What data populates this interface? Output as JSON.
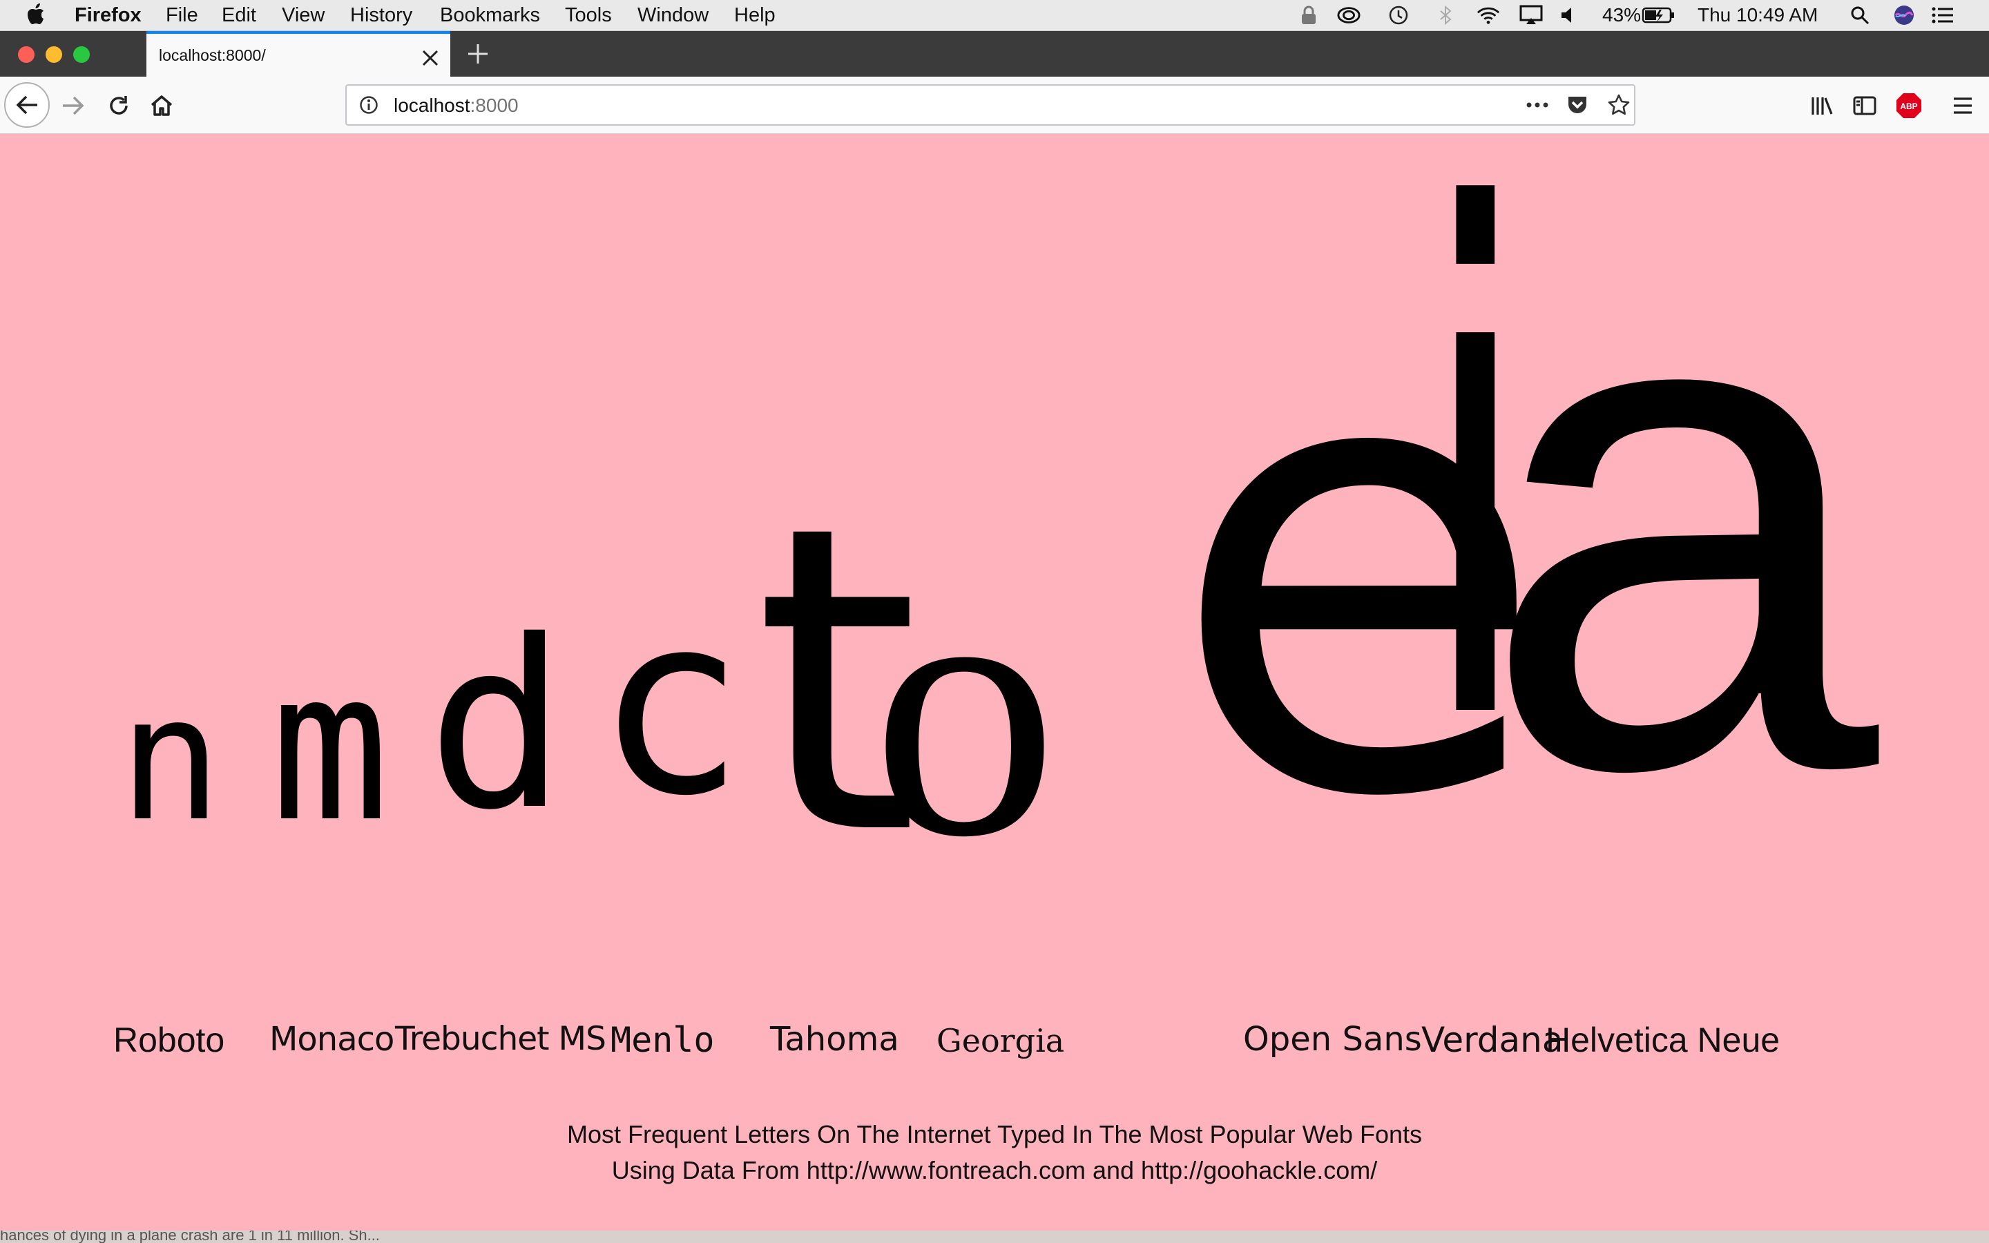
{
  "menubar": {
    "app_name": "Firefox",
    "items": [
      "File",
      "Edit",
      "View",
      "History",
      "Bookmarks",
      "Tools",
      "Window",
      "Help"
    ],
    "battery": "43%",
    "clock": "Thu 10:49 AM",
    "status_icons": [
      "lock-icon",
      "creative-cloud-icon",
      "time-machine-icon",
      "bluetooth-icon",
      "wifi-icon",
      "airplay-icon",
      "volume-icon",
      "battery-icon",
      "spotlight-icon",
      "siri-icon",
      "notification-center-icon"
    ]
  },
  "browser": {
    "tab_title": "localhost:8000/",
    "url_host": "localhost",
    "url_port": ":8000"
  },
  "page": {
    "glyphs": [
      "n",
      "m",
      "d",
      "c",
      "t",
      "o",
      "e",
      "i",
      "a"
    ],
    "fonts": [
      "Roboto",
      "Monaco",
      "Trebuchet MS",
      "Menlo",
      "Tahoma",
      "Georgia",
      "Open Sans",
      "Verdana",
      "Helvetica Neue"
    ],
    "caption_line1": "Most Frequent Letters On The Internet Typed In The Most Popular Web Fonts",
    "caption_line2": "Using Data From http://www.fontreach.com and http://goohackle.com/"
  },
  "background_snippet": "hances of dying in a plane crash are 1 in 11 million. Sh...",
  "colors": {
    "page_background": "#ffb3bc",
    "glyph_color": "#000000",
    "tab_accent": "#0a84ff",
    "abp_badge": "#e0001b"
  }
}
